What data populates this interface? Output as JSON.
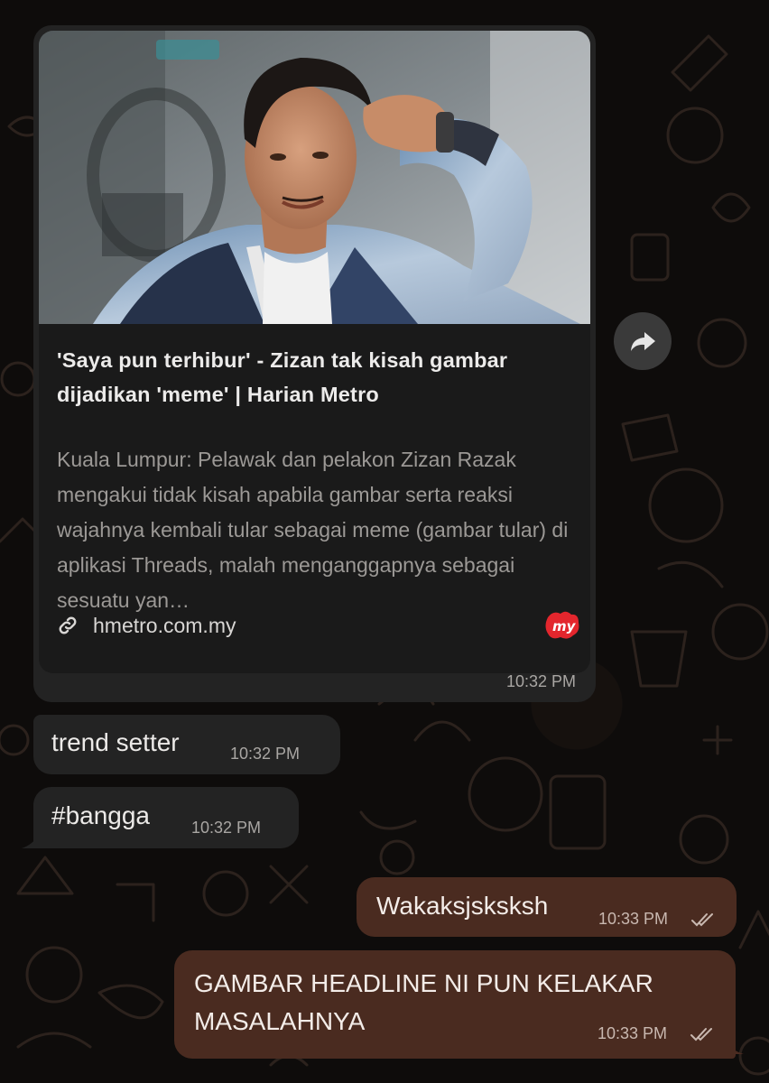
{
  "link_card": {
    "title": "'Saya pun terhibur' - Zizan tak kisah gambar dijadikan 'meme' | Harian Metro",
    "description": "Kuala Lumpur: Pelawak dan pelakon Zizan Razak mengakui tidak kisah apabila gambar serta reaksi wajahnya kembali tular sebagai meme (gambar tular) di aplikasi Threads, malah menganggapnya sebagai sesuatu yan…",
    "domain": "hmetro.com.my",
    "logo_text": "my",
    "time": "10:32 PM"
  },
  "messages": [
    {
      "text": "trend setter",
      "time": "10:32 PM",
      "direction": "incoming"
    },
    {
      "text": "#bangga",
      "time": "10:32 PM",
      "direction": "incoming"
    },
    {
      "text": "Wakaksjsksksh",
      "time": "10:33 PM",
      "direction": "outgoing",
      "status": "read"
    },
    {
      "text": "GAMBAR HEADLINE NI PUN KELAKAR MASALAHNYA",
      "time": "10:33 PM",
      "direction": "outgoing",
      "status": "read"
    }
  ],
  "colors": {
    "incoming_bubble": "#232323",
    "outgoing_bubble": "#4a2b20",
    "background": "#0e0c0b",
    "logo_red": "#e3262d"
  },
  "icons": {
    "forward": "forward-arrow-icon",
    "link": "link-icon",
    "read_receipt": "double-check-icon"
  }
}
